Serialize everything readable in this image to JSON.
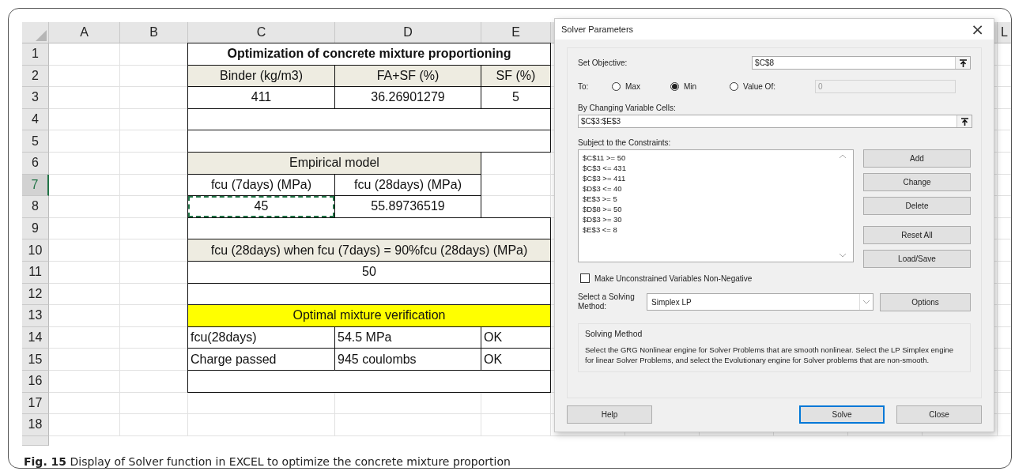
{
  "sheet": {
    "columns": [
      "A",
      "B",
      "C",
      "D",
      "E",
      "L"
    ],
    "rows": [
      {
        "label": "1",
        "selected": false,
        "cells": [
          {
            "kind": "empty"
          },
          {
            "kind": "empty"
          },
          {
            "kind": "title",
            "text": "Optimization of concrete mixture proportioning"
          }
        ]
      },
      {
        "label": "2",
        "selected": false,
        "cells": [
          {
            "kind": "empty"
          },
          {
            "kind": "empty"
          },
          {
            "kind": "header",
            "text": "Binder (kg/m3)"
          },
          {
            "kind": "header",
            "text": "FA+SF (%)"
          },
          {
            "kind": "header",
            "text": "SF (%)"
          }
        ]
      },
      {
        "label": "3",
        "selected": false,
        "cells": [
          {
            "kind": "empty"
          },
          {
            "kind": "empty"
          },
          {
            "kind": "value",
            "text": "411"
          },
          {
            "kind": "value",
            "text": "36.26901279"
          },
          {
            "kind": "value",
            "text": "5"
          }
        ]
      },
      {
        "label": "4",
        "selected": false,
        "cells": [
          {
            "kind": "empty"
          },
          {
            "kind": "empty"
          },
          {
            "kind": "frame"
          }
        ]
      },
      {
        "label": "5",
        "selected": false,
        "cells": [
          {
            "kind": "empty"
          },
          {
            "kind": "empty"
          },
          {
            "kind": "frame"
          }
        ]
      },
      {
        "label": "6",
        "selected": false,
        "cells": [
          {
            "kind": "empty"
          },
          {
            "kind": "empty"
          },
          {
            "kind": "band2",
            "text": "Empirical model"
          },
          {
            "kind": "empty"
          }
        ]
      },
      {
        "label": "7",
        "selected": true,
        "cells": [
          {
            "kind": "empty"
          },
          {
            "kind": "empty"
          },
          {
            "kind": "value",
            "text": "fcu (7days) (MPa)"
          },
          {
            "kind": "value",
            "text": "fcu (28days) (MPa)"
          },
          {
            "kind": "empty"
          }
        ]
      },
      {
        "label": "8",
        "selected": false,
        "cells": [
          {
            "kind": "empty"
          },
          {
            "kind": "empty"
          },
          {
            "kind": "copied",
            "text": "45"
          },
          {
            "kind": "value",
            "text": "55.89736519"
          },
          {
            "kind": "empty"
          }
        ]
      },
      {
        "label": "9",
        "selected": false,
        "cells": [
          {
            "kind": "empty"
          },
          {
            "kind": "empty"
          },
          {
            "kind": "frame"
          }
        ]
      },
      {
        "label": "10",
        "selected": false,
        "cells": [
          {
            "kind": "empty"
          },
          {
            "kind": "empty"
          },
          {
            "kind": "band",
            "text": "fcu (28days) when fcu (7days) = 90%fcu (28days) (MPa)"
          }
        ]
      },
      {
        "label": "11",
        "selected": false,
        "cells": [
          {
            "kind": "empty"
          },
          {
            "kind": "empty"
          },
          {
            "kind": "wide",
            "text": "50"
          }
        ]
      },
      {
        "label": "12",
        "selected": false,
        "cells": [
          {
            "kind": "empty"
          },
          {
            "kind": "empty"
          },
          {
            "kind": "frame"
          }
        ]
      },
      {
        "label": "13",
        "selected": false,
        "cells": [
          {
            "kind": "empty"
          },
          {
            "kind": "empty"
          },
          {
            "kind": "highlight",
            "text": "Optimal mixture verification"
          }
        ]
      },
      {
        "label": "14",
        "selected": false,
        "cells": [
          {
            "kind": "empty"
          },
          {
            "kind": "empty"
          },
          {
            "kind": "label",
            "text": "fcu(28days)"
          },
          {
            "kind": "label",
            "text": "54.5 MPa"
          },
          {
            "kind": "label",
            "text": "OK"
          }
        ]
      },
      {
        "label": "15",
        "selected": false,
        "cells": [
          {
            "kind": "empty"
          },
          {
            "kind": "empty"
          },
          {
            "kind": "label",
            "text": "Charge passed"
          },
          {
            "kind": "label",
            "text": "945 coulombs"
          },
          {
            "kind": "label",
            "text": "OK"
          }
        ]
      },
      {
        "label": "16",
        "selected": false,
        "cells": [
          {
            "kind": "empty"
          },
          {
            "kind": "empty"
          },
          {
            "kind": "frame"
          }
        ]
      },
      {
        "label": "17",
        "selected": false,
        "cells": [
          {
            "kind": "empty"
          },
          {
            "kind": "empty"
          },
          {
            "kind": "empty"
          },
          {
            "kind": "empty"
          },
          {
            "kind": "empty"
          }
        ]
      },
      {
        "label": "18",
        "selected": false,
        "cells": [
          {
            "kind": "empty"
          },
          {
            "kind": "empty"
          },
          {
            "kind": "empty"
          },
          {
            "kind": "empty"
          },
          {
            "kind": "empty"
          }
        ]
      }
    ]
  },
  "dialog": {
    "title": "Solver Parameters",
    "close": "×",
    "objective": {
      "label": "Set Objective:",
      "value": "$C$8"
    },
    "to": {
      "label": "To:",
      "options": [
        {
          "label": "Max",
          "selected": false
        },
        {
          "label": "Min",
          "selected": true
        },
        {
          "label": "Value Of:",
          "selected": false
        }
      ],
      "value": "0",
      "value_disabled": true
    },
    "changing": {
      "label": "By Changing Variable Cells:",
      "value": "$C$3:$E$3"
    },
    "constraints": {
      "label": "Subject to the Constraints:",
      "items": [
        "$C$11 >= 50",
        "$C$3 <= 431",
        "$C$3 >= 411",
        "$D$3 <= 40",
        "$E$3 >= 5",
        "$D$8 >= 50",
        "$D$3 >= 30",
        "$E$3 <= 8"
      ]
    },
    "side_buttons": [
      "Add",
      "Change",
      "Delete",
      "Reset All",
      "Load/Save"
    ],
    "nonnegative": {
      "label": "Make Unconstrained Variables Non-Negative",
      "checked": false
    },
    "method": {
      "label": "Select a Solving Method:",
      "value": "Simplex LP",
      "button": "Options"
    },
    "method_info": {
      "title": "Solving Method",
      "text": "Select the GRG Nonlinear engine for Solver Problems that are smooth nonlinear. Select the LP Simplex engine for linear Solver Problems, and select the Evolutionary engine for Solver problems that are non-smooth."
    },
    "buttons": [
      {
        "label": "Help",
        "default": false
      },
      {
        "label": "Solve",
        "default": true
      },
      {
        "label": "Close",
        "default": false
      }
    ]
  },
  "caption": "**Fig. 15**  Display of Solver function in EXCEL to optimize the concrete mixture proportion"
}
